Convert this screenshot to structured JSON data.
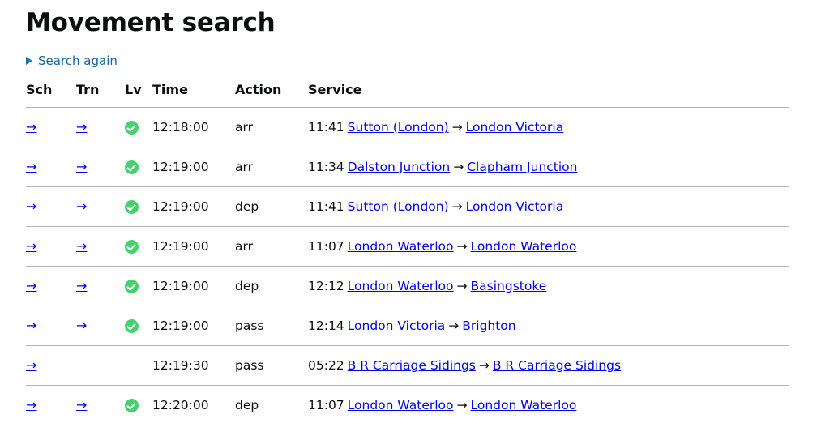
{
  "page": {
    "title": "Movement search"
  },
  "search_again": {
    "label": "Search again",
    "triangle_icon": "disclosure-triangle-icon",
    "link_color": "#1565a0"
  },
  "table": {
    "columns": [
      "Sch",
      "Trn",
      "Lv",
      "Time",
      "Action",
      "Service"
    ],
    "arrow_glyph": "→",
    "separator_glyph": "→",
    "tick_icon": "green-check-icon",
    "accent_colors": {
      "link": "#0000ee",
      "tick": "#47d16c",
      "rule": "#b1b4b6"
    },
    "rows": [
      {
        "sch": "→",
        "trn": "→",
        "lv": true,
        "time": "12:18:00",
        "action": "arr",
        "service_time": "11:41",
        "origin": "Sutton (London)",
        "destination": "London Victoria"
      },
      {
        "sch": "→",
        "trn": "→",
        "lv": true,
        "time": "12:19:00",
        "action": "arr",
        "service_time": "11:34",
        "origin": "Dalston Junction",
        "destination": "Clapham Junction"
      },
      {
        "sch": "→",
        "trn": "→",
        "lv": true,
        "time": "12:19:00",
        "action": "dep",
        "service_time": "11:41",
        "origin": "Sutton (London)",
        "destination": "London Victoria"
      },
      {
        "sch": "→",
        "trn": "→",
        "lv": true,
        "time": "12:19:00",
        "action": "arr",
        "service_time": "11:07",
        "origin": "London Waterloo",
        "destination": "London Waterloo"
      },
      {
        "sch": "→",
        "trn": "→",
        "lv": true,
        "time": "12:19:00",
        "action": "dep",
        "service_time": "12:12",
        "origin": "London Waterloo",
        "destination": "Basingstoke"
      },
      {
        "sch": "→",
        "trn": "→",
        "lv": true,
        "time": "12:19:00",
        "action": "pass",
        "service_time": "12:14",
        "origin": "London Victoria",
        "destination": "Brighton"
      },
      {
        "sch": "→",
        "trn": "",
        "lv": false,
        "time": "12:19:30",
        "action": "pass",
        "service_time": "05:22",
        "origin": "B R Carriage Sidings",
        "destination": "B R Carriage Sidings"
      },
      {
        "sch": "→",
        "trn": "→",
        "lv": true,
        "time": "12:20:00",
        "action": "dep",
        "service_time": "11:07",
        "origin": "London Waterloo",
        "destination": "London Waterloo"
      }
    ]
  }
}
